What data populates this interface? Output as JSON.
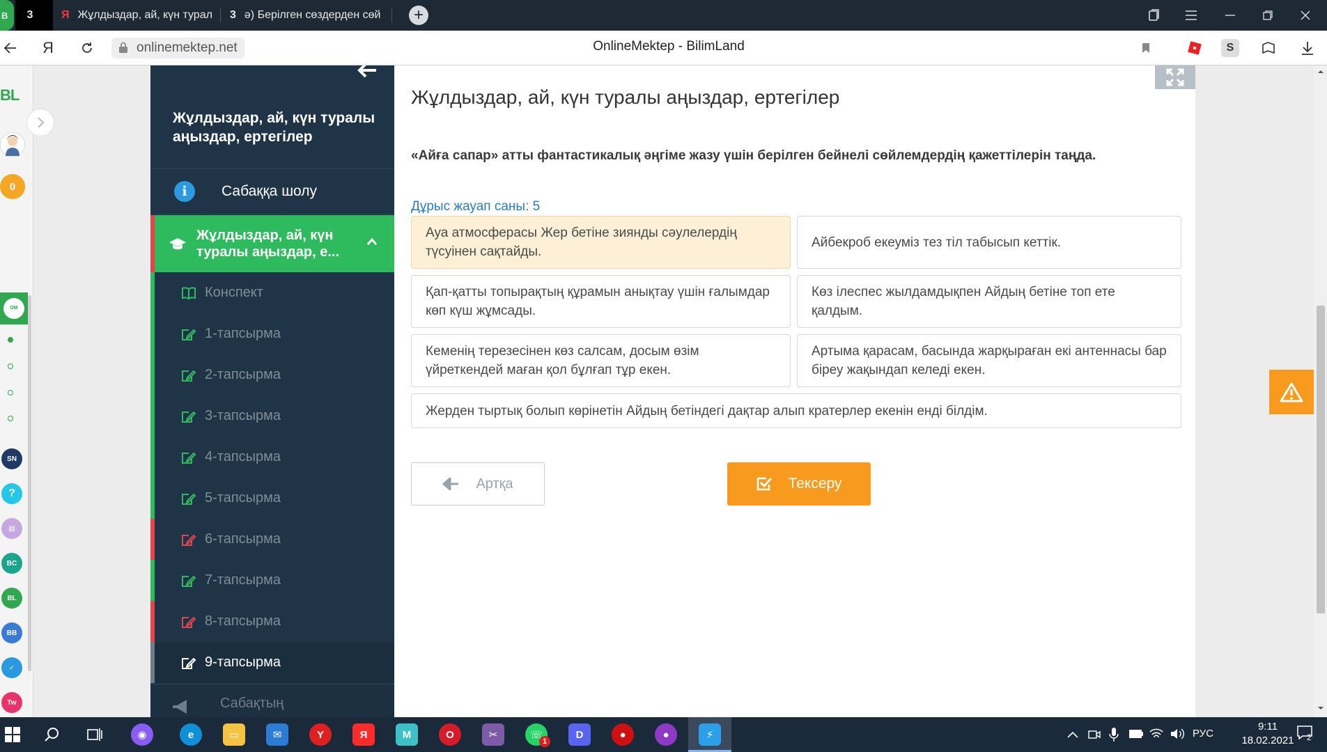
{
  "browser": {
    "tabs": [
      {
        "favicon": "3",
        "title": "",
        "active": true
      },
      {
        "favicon": "Я",
        "title": "Жұлдыздар, ай, күн турал",
        "active": false
      },
      {
        "favicon": "3",
        "title": "ә) Берілген сөздерден сөй",
        "active": false
      }
    ],
    "url": "onlinemektep.net",
    "page_title": "OnlineMektep - BilimLand",
    "extension_badge": "S"
  },
  "browser_sidebar": {
    "logo": "BL",
    "score": "0"
  },
  "course": {
    "title": "Жұлдыздар, ай, күн туралы аңыздар, ертегілер",
    "overview_label": "Сабаққа шолу",
    "active_topic": "Жұлдыздар, ай, күн туралы аңыздар, е...",
    "items": [
      {
        "label": "Конспект",
        "icon": "book-icon",
        "mark": "green",
        "current": false
      },
      {
        "label": "1-тапсырма",
        "icon": "edit-icon",
        "mark": "green",
        "current": false
      },
      {
        "label": "2-тапсырма",
        "icon": "edit-icon",
        "mark": "green",
        "current": false
      },
      {
        "label": "3-тапсырма",
        "icon": "edit-icon",
        "mark": "green",
        "current": false
      },
      {
        "label": "4-тапсырма",
        "icon": "edit-icon",
        "mark": "green",
        "current": false
      },
      {
        "label": "5-тапсырма",
        "icon": "edit-icon",
        "mark": "green",
        "current": false
      },
      {
        "label": "6-тапсырма",
        "icon": "edit-icon",
        "mark": "red",
        "current": false
      },
      {
        "label": "7-тапсырма",
        "icon": "edit-icon",
        "mark": "green",
        "current": false
      },
      {
        "label": "8-тапсырма",
        "icon": "edit-icon",
        "mark": "red",
        "current": false
      },
      {
        "label": "9-тапсырма",
        "icon": "edit-icon",
        "mark": "none",
        "current": true
      }
    ],
    "bottom_label": "Сабақтың"
  },
  "main": {
    "lesson_heading": "Жұлдыздар, ай, күн туралы аңыздар, ертегілер",
    "question": "«Айға сапар» атты фантастикалық әңгіме жазу үшін берілген бейнелі сөйлемдердің қажеттілерін таңда.",
    "correct_count": "Дұрыс жауап саны: 5",
    "options": [
      {
        "text": "Ауа атмосферасы Жер бетіне зиянды сәулелердің түсуінен сақтайды.",
        "selected": true
      },
      {
        "text": "Айбекроб екеуміз тез тіл табысып кеттік.",
        "selected": false
      },
      {
        "text": "Қап-қатты топырақтың құрамын анықтау үшін ғалымдар көп күш жұмсады.",
        "selected": false
      },
      {
        "text": "Көз ілеспес жылдамдықпен Айдың бетіне топ ете қалдым.",
        "selected": false
      },
      {
        "text": "Кеменің терезесінен көз салсам, досым өзім үйреткендей маған қол бұлғап тұр екен.",
        "selected": false
      },
      {
        "text": "Артыма қарасам, басында жарқыраған екі антеннасы бар біреу жақындап келеді екен.",
        "selected": false
      },
      {
        "text": "Жерден тыртық болып көрінетін Айдың бетіндегі дақтар алып кратерлер екенін енді білдім.",
        "selected": false
      }
    ],
    "back_label": "Артқа",
    "check_label": "Тексеру"
  },
  "taskbar": {
    "language": "РУС",
    "time": "9:11",
    "date": "18.02.2021",
    "notifications": "2",
    "whatsapp_badge": "1"
  },
  "colors": {
    "sidebar_bg": "#1f3547",
    "active_green": "#2dbb5d",
    "error_red": "#e5444d",
    "accent_orange": "#f79a1d",
    "link_blue": "#2a7bbf",
    "selected_option_bg": "#fdf0d6"
  }
}
